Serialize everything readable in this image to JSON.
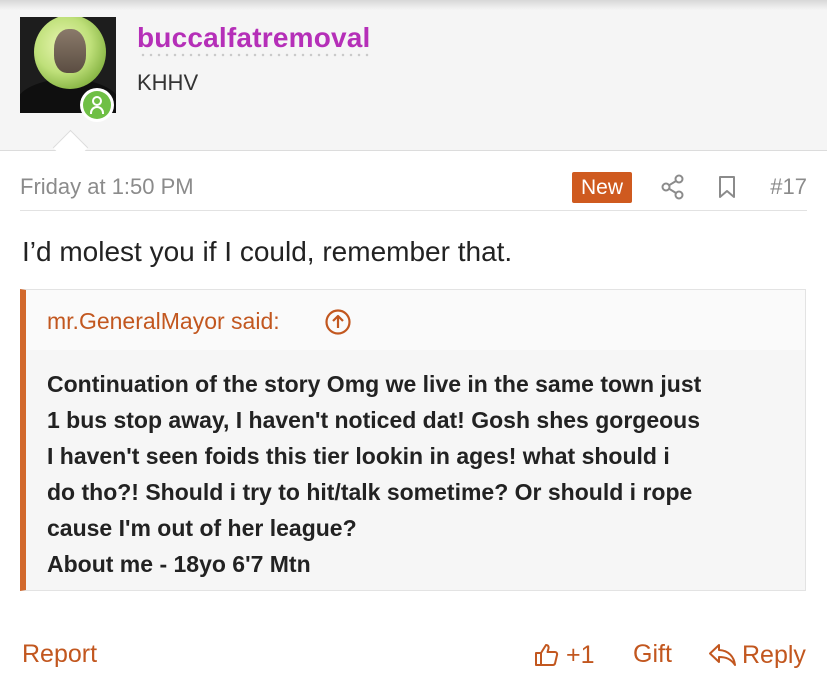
{
  "author": {
    "username": "buccalfatremoval",
    "user_title": "KHHV",
    "avatar": "avatar-lettuce-head",
    "online_status_icon": "user-online-icon"
  },
  "post": {
    "date": "Friday at 1:50 PM",
    "new_badge": "New",
    "number": "#17",
    "share_icon": "share-icon",
    "bookmark_icon": "bookmark-icon",
    "text": "I’d molest you if I could, remember that."
  },
  "quote": {
    "attribution": "mr.GeneralMayor said:",
    "lines": [
      "Continuation of the story Omg we live in the same town just",
      "1 bus stop away, I haven't noticed dat! Gosh shes gorgeous",
      "I haven't seen foids this tier lookin in ages! what should i",
      "do tho?! Should i try to hit/talk sometime? Or should i rope",
      "cause I'm out of her league?",
      "About me - 18yo 6'7 Mtn"
    ]
  },
  "actions": {
    "report": "Report",
    "reaction_count": "+1",
    "gift": "Gift",
    "reply": "Reply"
  },
  "colors": {
    "username": "#b52fb8",
    "accent": "#c2571f",
    "new_badge": "#cf5a1f",
    "online": "#6fbf45"
  }
}
